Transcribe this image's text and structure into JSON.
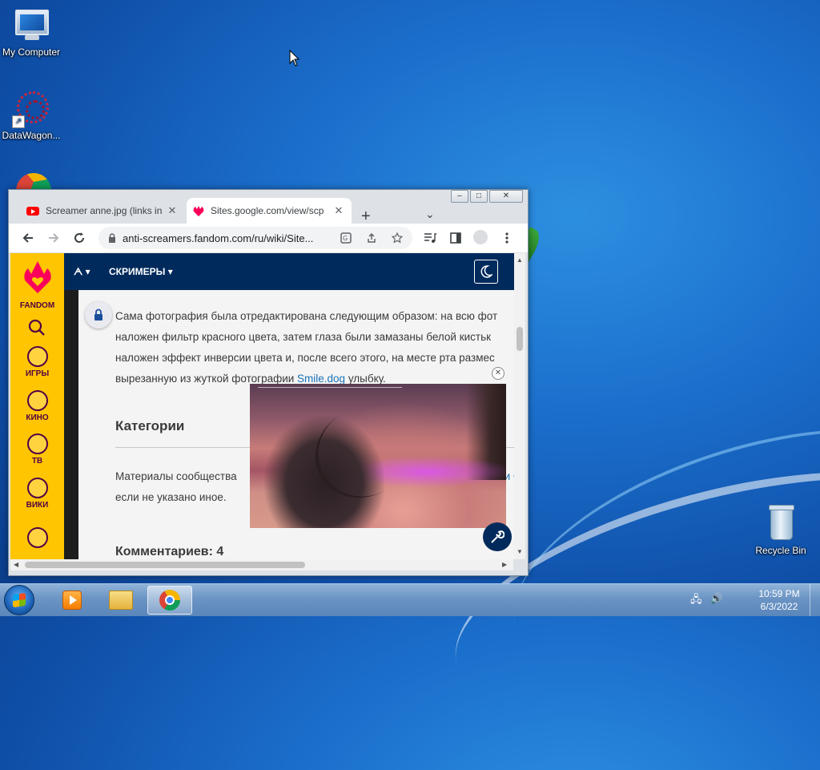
{
  "desktop": {
    "icons": [
      {
        "label": "My Computer"
      },
      {
        "label": "DataWagon..."
      },
      {
        "label": "Recycle Bin"
      }
    ]
  },
  "browser": {
    "window_controls": {
      "minimize": "‒",
      "maximize": "□",
      "close": "✕"
    },
    "tabs": [
      {
        "title": "Screamer anne.jpg (links in",
        "active": false
      },
      {
        "title": "Sites.google.com/view/scp",
        "active": true
      }
    ],
    "new_tab": "+",
    "tab_search": "⌄",
    "address": "anti-screamers.fandom.com/ru/wiki/Site..."
  },
  "fandom": {
    "brand": "FANDOM",
    "rail": [
      {
        "label": "ИГРЫ"
      },
      {
        "label": "КИНО"
      },
      {
        "label": "ТВ"
      },
      {
        "label": "ВИКИ"
      }
    ],
    "nav": {
      "wiki_menu": "ᗅ",
      "screamers": "СКРИМЕРЫ"
    }
  },
  "article": {
    "paragraph_lines": [
      "Сама фотография была отредактирована следующим образом: на всю фот",
      "наложен фильтр красного цвета, затем глаза были замазаны белой кистьк",
      "наложен эффект инверсии цвета и, после всего этого, на месте рта размес"
    ],
    "last_line_prefix": "вырезанную из жуткой фотографии ",
    "last_line_link": "Smile.dog",
    "last_line_suffix": " улыбку.",
    "categories_heading": "Категории",
    "community_line1_start": "Материалы сообщества",
    "community_line1_end": "и С",
    "community_line2": "если не указано иное.",
    "comments_heading": "Комментариев: 4"
  },
  "taskbar": {
    "time": "10:59 PM",
    "date": "6/3/2022"
  }
}
